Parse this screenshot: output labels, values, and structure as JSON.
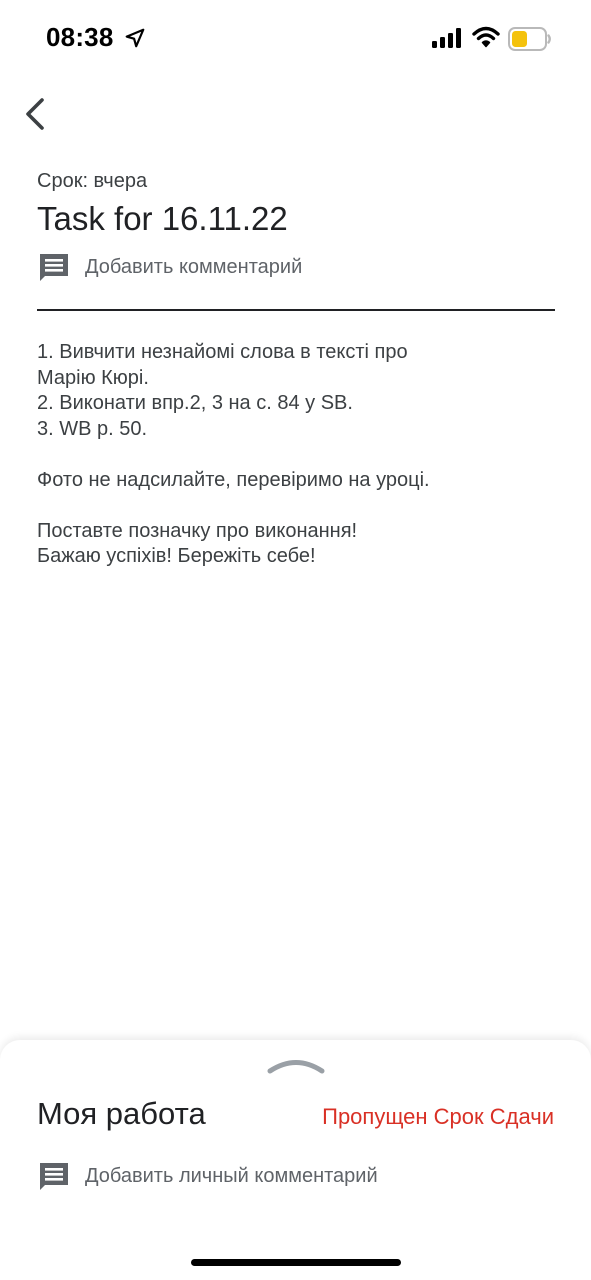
{
  "status_bar": {
    "time": "08:38",
    "icons": [
      "location-arrow-icon",
      "cellular-signal-icon",
      "wifi-icon",
      "battery-icon"
    ],
    "battery_color": "#f4c20d"
  },
  "nav": {
    "back_icon": "chevron-left-icon"
  },
  "assignment": {
    "due_label": "Срок: вчера",
    "title": "Task for 16.11.22",
    "add_comment_label": "Добавить комментарий",
    "instructions": {
      "line1": "1. Вивчити незнайомі слова в тексті про",
      "line2": "Марію Кюрі.",
      "line3": "2. Виконати впр.2, 3 на с. 84 у SB.",
      "line4": "3. WB p. 50.",
      "line5": "Фото не надсилайте, перевіримо на уроці.",
      "line6": "Поставте позначку про виконання!",
      "line7": "Бажаю успіхів! Бережіть себе!"
    }
  },
  "my_work": {
    "title": "Моя работа",
    "status": "Пропущен Срок Сдачи",
    "status_color": "#d93025",
    "add_private_comment_label": "Добавить личный комментарий"
  }
}
